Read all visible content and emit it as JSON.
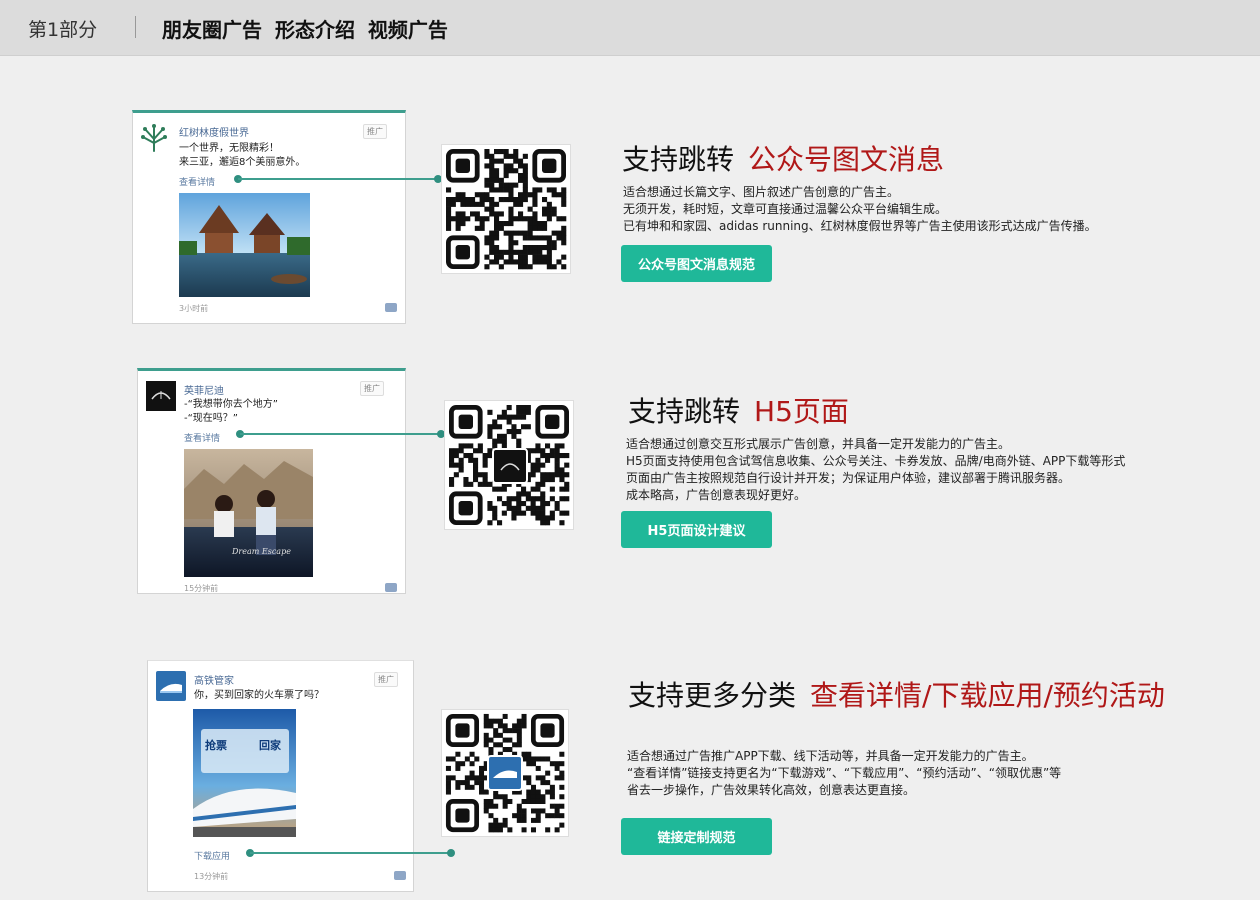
{
  "header": {
    "part": "第1部分",
    "title": "朋友圈广告  形态介绍  视频广告"
  },
  "cards": [
    {
      "account": "红树林度假世界",
      "tag": "推广",
      "lines": [
        "一个世界，无限精彩！",
        "来三亚，邂逅8个美丽意外。"
      ],
      "link": "查看详情",
      "time": "3小时前"
    },
    {
      "account": "英菲尼迪",
      "tag": "推广",
      "lines": [
        "-“我想带你去个地方”",
        "-“现在吗？”"
      ],
      "link": "查看详情",
      "time": "15分钟前",
      "photo_caption": "Dream Escape"
    },
    {
      "account": "高铁管家",
      "tag": "推广",
      "lines": [
        "你，买到回家的火车票了吗？"
      ],
      "link": "下载应用",
      "time": "13分钟前",
      "poster_text": [
        "抢票",
        "回家"
      ]
    }
  ],
  "sections": [
    {
      "heading": "支持跳转",
      "heading_red": "公众号图文消息",
      "desc": [
        "适合想通过长篇文字、图片叙述广告创意的广告主。",
        "无须开发，耗时短，文章可直接通过温馨公众平台编辑生成。",
        "已有坤和和家园、adidas running、红树林度假世界等广告主使用该形式达成广告传播。"
      ],
      "button": "公众号图文消息规范"
    },
    {
      "heading": "支持跳转",
      "heading_red": "H5页面",
      "desc": [
        "适合想通过创意交互形式展示广告创意，并具备一定开发能力的广告主。",
        "H5页面支持使用包含试驾信息收集、公众号关注、卡券发放、品牌/电商外链、APP下载等形式",
        "页面由广告主按照规范自行设计并开发；为保证用户体验，建议部署于腾讯服务器。",
        "成本略高，广告创意表现好更好。"
      ],
      "button": "H5页面设计建议"
    },
    {
      "heading": "支持更多分类",
      "heading_red": "查看详情/下载应用/预约活动",
      "desc": [
        "适合想通过广告推广APP下载、线下活动等，并具备一定开发能力的广告主。",
        "“查看详情”链接支持更名为“下载游戏”、“下载应用”、“预约活动”、“领取优惠”等",
        "省去一步操作，广告效果转化高效，创意表达更直接。"
      ],
      "button": "链接定制规范"
    }
  ],
  "colors": {
    "accent": "#1fb899",
    "leader": "#3e9e8e",
    "heading_red": "#b01818"
  }
}
